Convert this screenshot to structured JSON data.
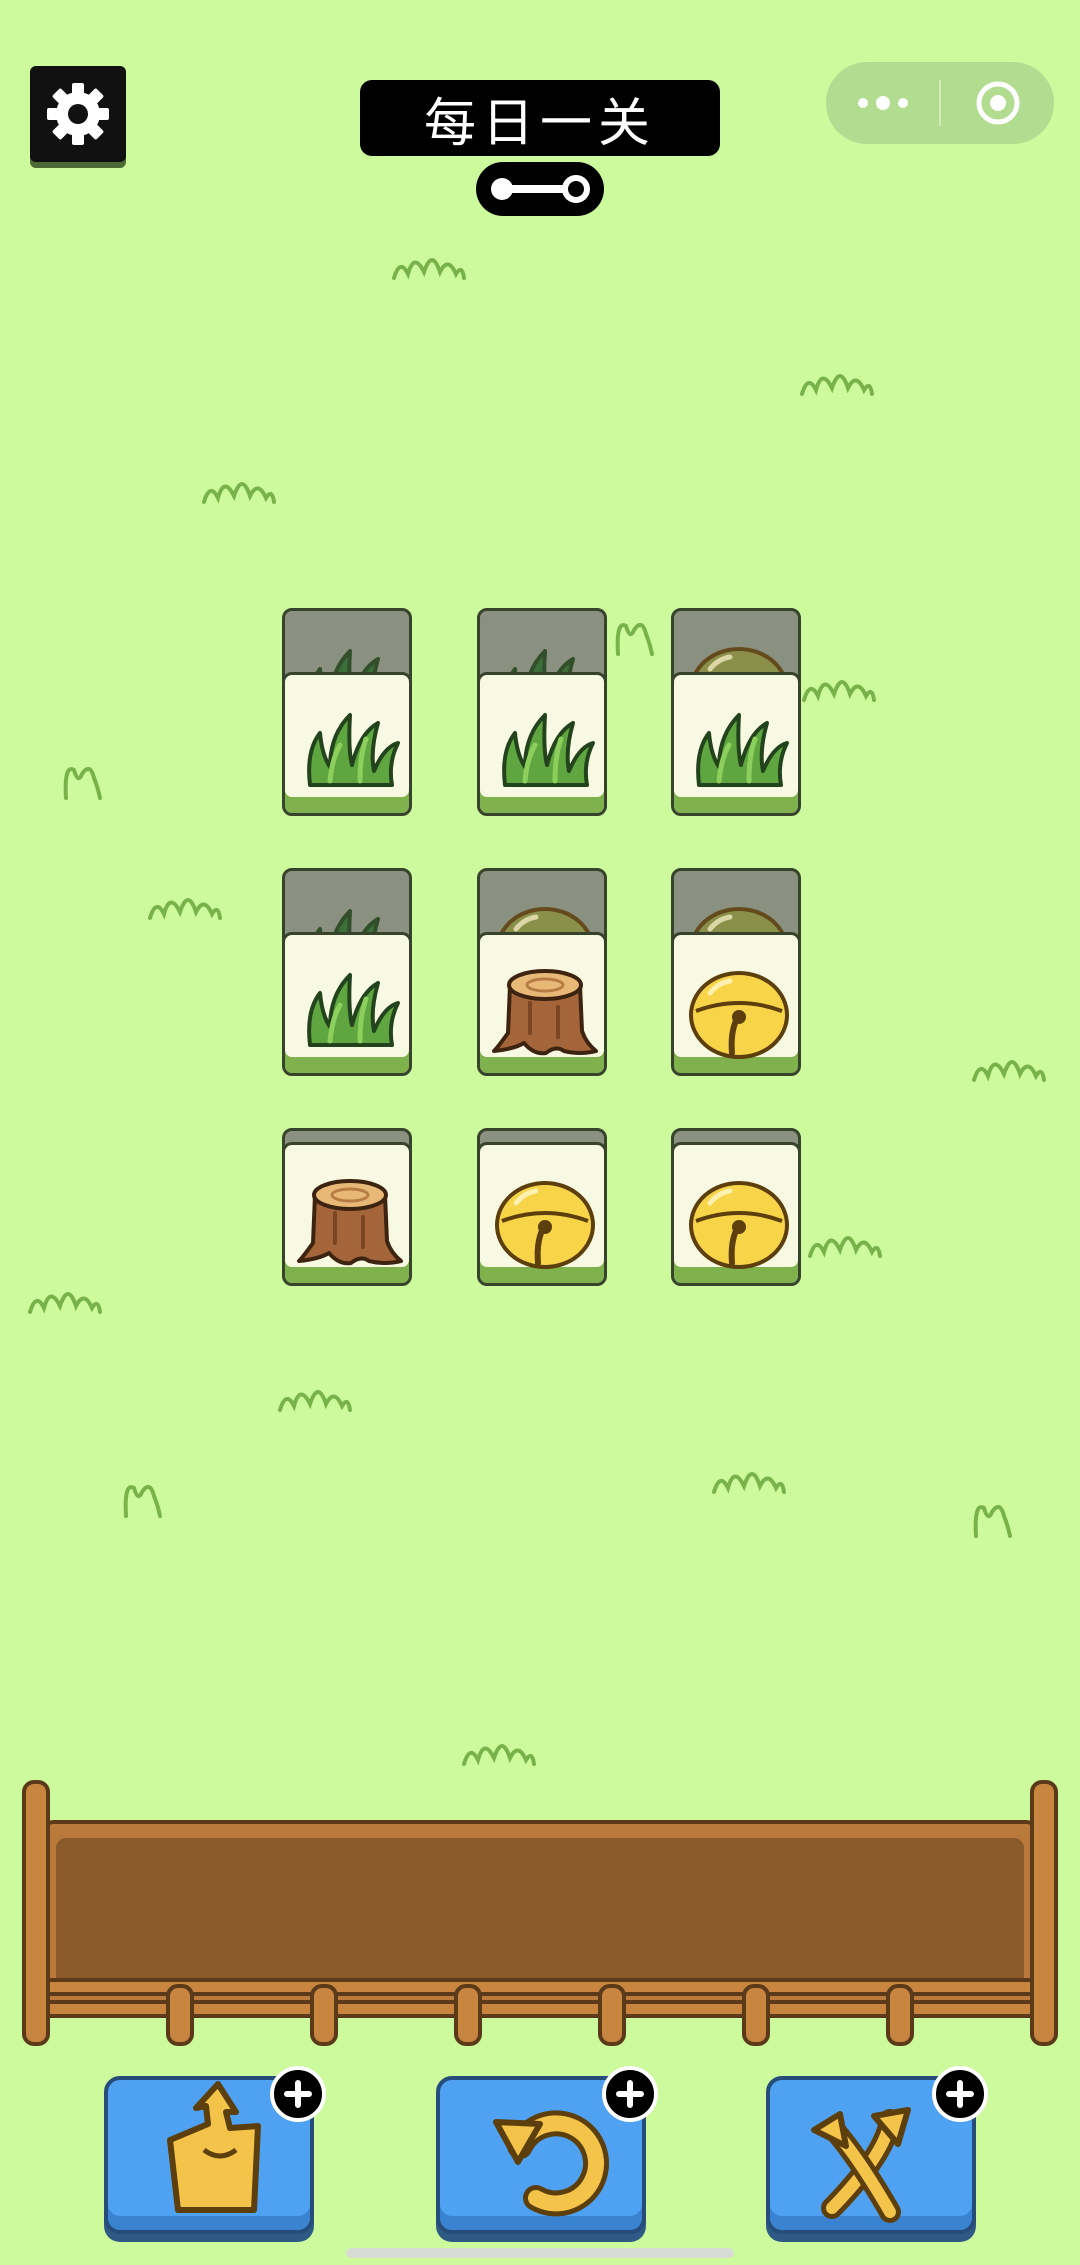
{
  "app": {
    "title": "每日一关"
  },
  "header": {
    "settings_icon": "gear-icon",
    "progress_icon": "key-icon",
    "menu_icon": "more-dots-icon",
    "close_icon": "target-circle-icon"
  },
  "board": {
    "rows": [
      [
        {
          "top": "grass",
          "bottom": "grass"
        },
        {
          "top": "grass",
          "bottom": "grass"
        },
        {
          "top": "grass",
          "bottom": "bell"
        }
      ],
      [
        {
          "top": "grass",
          "bottom": "grass"
        },
        {
          "top": "stump",
          "bottom": "bell"
        },
        {
          "top": "bell",
          "bottom": "bell"
        }
      ],
      [
        {
          "top": "stump",
          "bottom": null
        },
        {
          "top": "bell",
          "bottom": null
        },
        {
          "top": "bell",
          "bottom": null
        }
      ]
    ]
  },
  "tray": {
    "slots": []
  },
  "tools": [
    {
      "name": "move-out",
      "icon": "move-out-icon"
    },
    {
      "name": "undo",
      "icon": "undo-icon"
    },
    {
      "name": "shuffle",
      "icon": "shuffle-icon"
    }
  ],
  "colors": {
    "background": "#ccfa9c",
    "tile_face": "#f7f9e2",
    "tile_base": "#7fb24c",
    "tray_wood": "#ba7a3c",
    "tool_blue": "#4fa2f2"
  }
}
